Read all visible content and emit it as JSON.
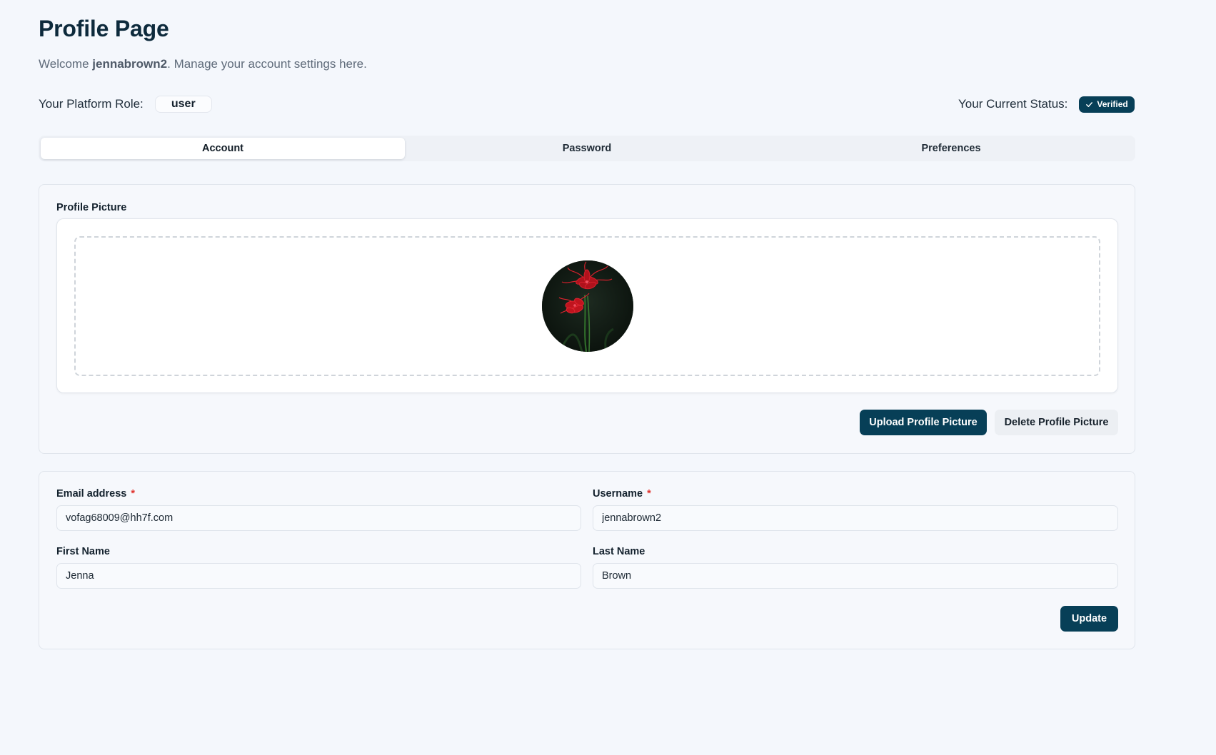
{
  "page": {
    "title": "Profile Page",
    "welcome_prefix": "Welcome ",
    "username_display": "jennabrown2",
    "welcome_suffix": ". Manage your account settings here."
  },
  "role": {
    "label": "Your Platform Role:",
    "value": "user"
  },
  "status": {
    "label": "Your Current Status:",
    "badge": "Verified",
    "badge_color": "#073f57"
  },
  "tabs": [
    {
      "label": "Account",
      "active": true
    },
    {
      "label": "Password",
      "active": false
    },
    {
      "label": "Preferences",
      "active": false
    }
  ],
  "profile_picture": {
    "label": "Profile Picture",
    "image": "red-spider-lily-flower",
    "upload_label": "Upload Profile Picture",
    "delete_label": "Delete Profile Picture"
  },
  "form": {
    "email": {
      "label": "Email address",
      "required_mark": "*",
      "value": "vofag68009@hh7f.com"
    },
    "username": {
      "label": "Username",
      "required_mark": "*",
      "value": "jennabrown2"
    },
    "first_name": {
      "label": "First Name",
      "value": "Jenna"
    },
    "last_name": {
      "label": "Last Name",
      "value": "Brown"
    },
    "update_label": "Update"
  },
  "colors": {
    "primary": "#073f57",
    "background": "#f4f7fc",
    "required": "#e0322d"
  }
}
